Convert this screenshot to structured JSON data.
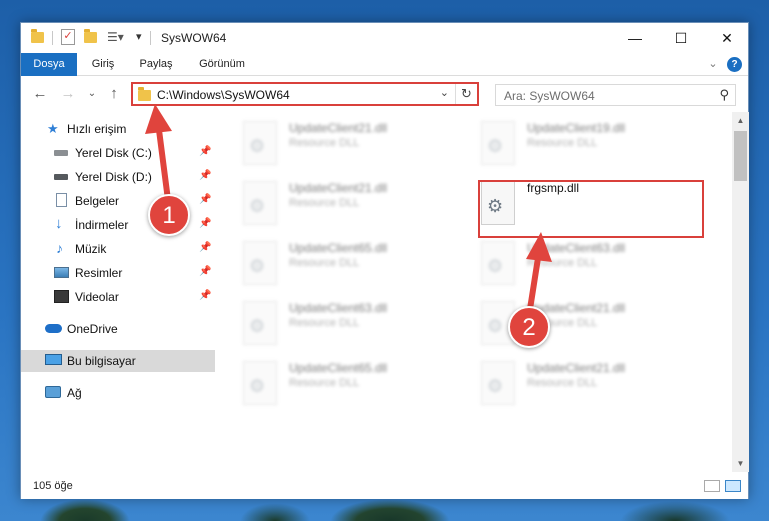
{
  "window": {
    "title": "SysWOW64"
  },
  "ribbon": {
    "tabs": [
      "Dosya",
      "Giriş",
      "Paylaş",
      "Görünüm"
    ]
  },
  "address": {
    "path": "C:\\Windows\\SysWOW64"
  },
  "search": {
    "placeholder": "Ara: SysWOW64"
  },
  "sidebar": {
    "quick_access": "Hızlı erişim",
    "items": [
      {
        "label": "Yerel Disk (C:)",
        "icon": "drive-icon"
      },
      {
        "label": "Yerel Disk (D:)",
        "icon": "drive-icon"
      },
      {
        "label": "Belgeler",
        "icon": "documents-icon"
      },
      {
        "label": "İndirmeler",
        "icon": "download-icon"
      },
      {
        "label": "Müzik",
        "icon": "music-icon"
      },
      {
        "label": "Resimler",
        "icon": "pictures-icon"
      },
      {
        "label": "Videolar",
        "icon": "videos-icon"
      }
    ],
    "onedrive": "OneDrive",
    "this_pc": "Bu bilgisayar",
    "network": "Ağ"
  },
  "files": [
    {
      "name": "UpdateClient21.dll",
      "type": "Resource DLL"
    },
    {
      "name": "UpdateClient19.dll",
      "type": "Resource DLL"
    },
    {
      "name": "UpdateClient21.dll",
      "type": "Resource DLL"
    },
    {
      "name": "frgsmp.dll",
      "type": ""
    },
    {
      "name": "UpdateClient65.dll",
      "type": "Resource DLL"
    },
    {
      "name": "UpdateClient63.dll",
      "type": "Resource DLL"
    },
    {
      "name": "UpdateClient63.dll",
      "type": "Resource DLL"
    },
    {
      "name": "UpdateClient21.dll",
      "type": "Resource DLL"
    },
    {
      "name": "UpdateClient65.dll",
      "type": "Resource DLL"
    },
    {
      "name": "UpdateClient21.dll",
      "type": "Resource DLL"
    }
  ],
  "status": {
    "count": "105 öğe"
  },
  "annotations": {
    "step1": "1",
    "step2": "2"
  },
  "colors": {
    "accent": "#1a6fc2",
    "highlight": "#d9403b"
  }
}
